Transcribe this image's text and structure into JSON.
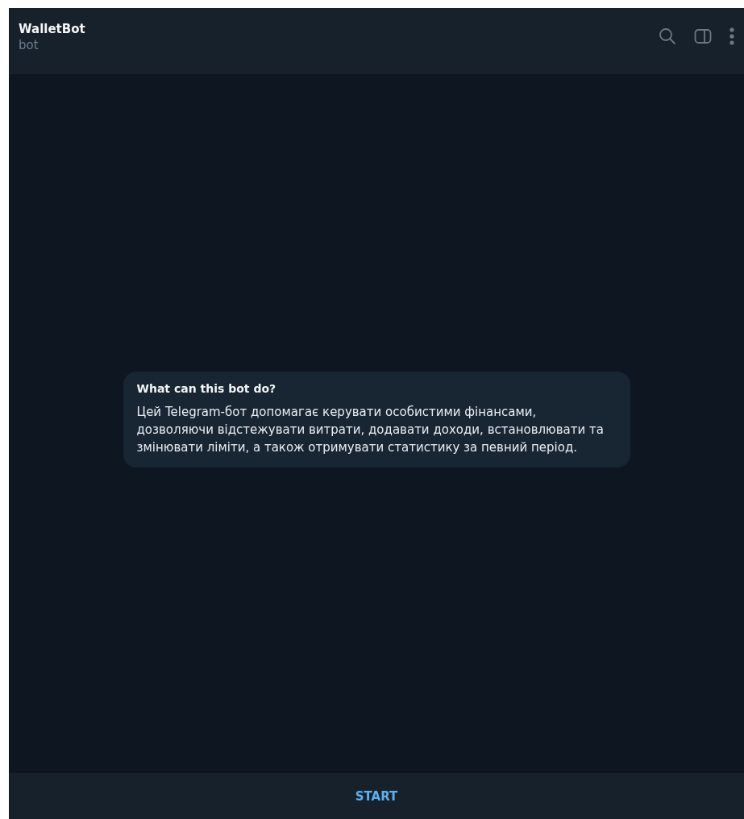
{
  "header": {
    "title": "WalletBot",
    "subtitle": "bot"
  },
  "info_card": {
    "title": "What can this bot do?",
    "text": "Цей Telegram-бот допомагає керувати особистими фінансами, дозволяючи відстежувати витрати, додавати доходи, встановлювати та змінювати ліміти, а також отримувати статистику за певний період."
  },
  "start_button": {
    "label": "START"
  }
}
